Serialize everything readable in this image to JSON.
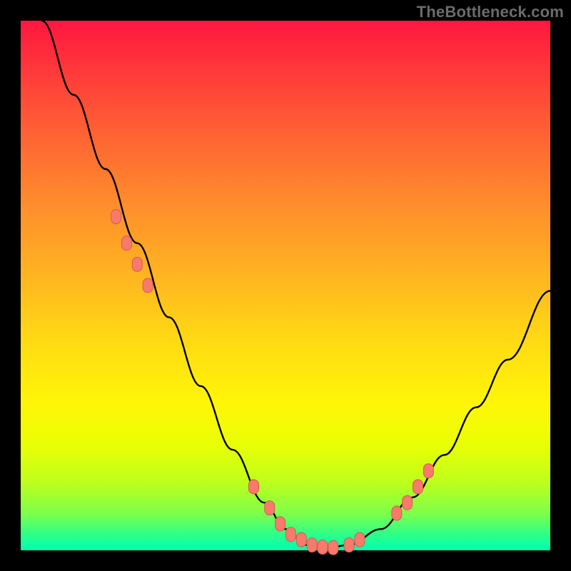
{
  "watermark": "TheBottleneck.com",
  "colors": {
    "frame": "#000000",
    "curve": "#000000",
    "marker_fill": "#f77a6d",
    "marker_stroke": "#d95a4c"
  },
  "chart_data": {
    "type": "line",
    "title": "",
    "xlabel": "",
    "ylabel": "",
    "xlim": [
      0,
      100
    ],
    "ylim": [
      0,
      100
    ],
    "grid": false,
    "legend": false,
    "annotations": [
      "TheBottleneck.com"
    ],
    "x": [
      4,
      10,
      16,
      22,
      28,
      34,
      40,
      46,
      50,
      54,
      58,
      62,
      68,
      74,
      80,
      86,
      92,
      100
    ],
    "values": [
      100,
      86,
      72,
      58,
      44,
      31,
      19,
      9,
      4,
      1,
      0.5,
      1,
      4,
      10,
      18,
      27,
      36,
      49
    ],
    "series": [
      {
        "name": "bottleneck-curve",
        "x": [
          4,
          10,
          16,
          22,
          28,
          34,
          40,
          46,
          50,
          54,
          58,
          62,
          68,
          74,
          80,
          86,
          92,
          100
        ],
        "values": [
          100,
          86,
          72,
          58,
          44,
          31,
          19,
          9,
          4,
          1,
          0.5,
          1,
          4,
          10,
          18,
          27,
          36,
          49
        ]
      }
    ],
    "markers": {
      "name": "highlighted-points",
      "clusters": [
        {
          "x": [
            18,
            20,
            22,
            24
          ],
          "values": [
            63,
            58,
            54,
            50
          ]
        },
        {
          "x": [
            44,
            47,
            49,
            51,
            53,
            55,
            57,
            59,
            62,
            64
          ],
          "values": [
            12,
            8,
            5,
            3,
            2,
            1,
            0.6,
            0.5,
            1,
            2
          ]
        },
        {
          "x": [
            71,
            73,
            75,
            77
          ],
          "values": [
            7,
            9,
            12,
            15
          ]
        }
      ]
    }
  }
}
